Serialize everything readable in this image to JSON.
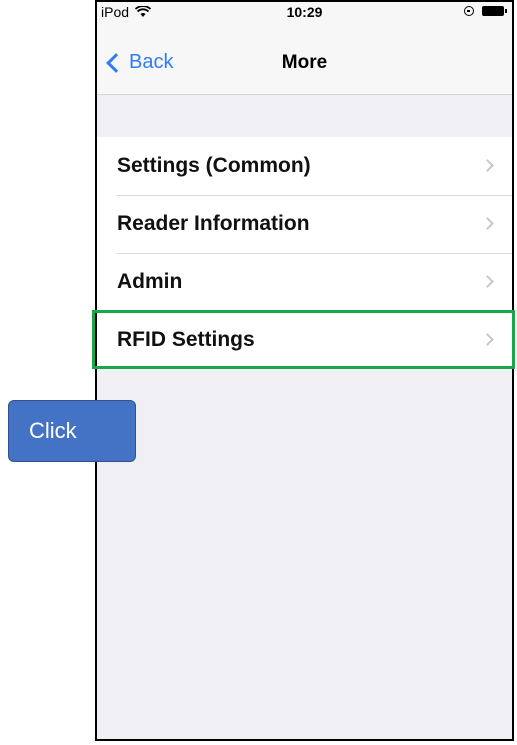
{
  "status_bar": {
    "carrier": "iPod",
    "time": "10:29"
  },
  "nav": {
    "back_label": "Back",
    "title": "More"
  },
  "menu": {
    "items": [
      {
        "label": "Settings (Common)"
      },
      {
        "label": "Reader Information"
      },
      {
        "label": "Admin"
      },
      {
        "label": "RFID Settings"
      }
    ]
  },
  "annotation": {
    "callout_text": "Click",
    "highlight_color": "#1aa74a",
    "callout_color": "#4473c5"
  },
  "colors": {
    "accent": "#2f7cf6",
    "background": "#efeff4"
  }
}
